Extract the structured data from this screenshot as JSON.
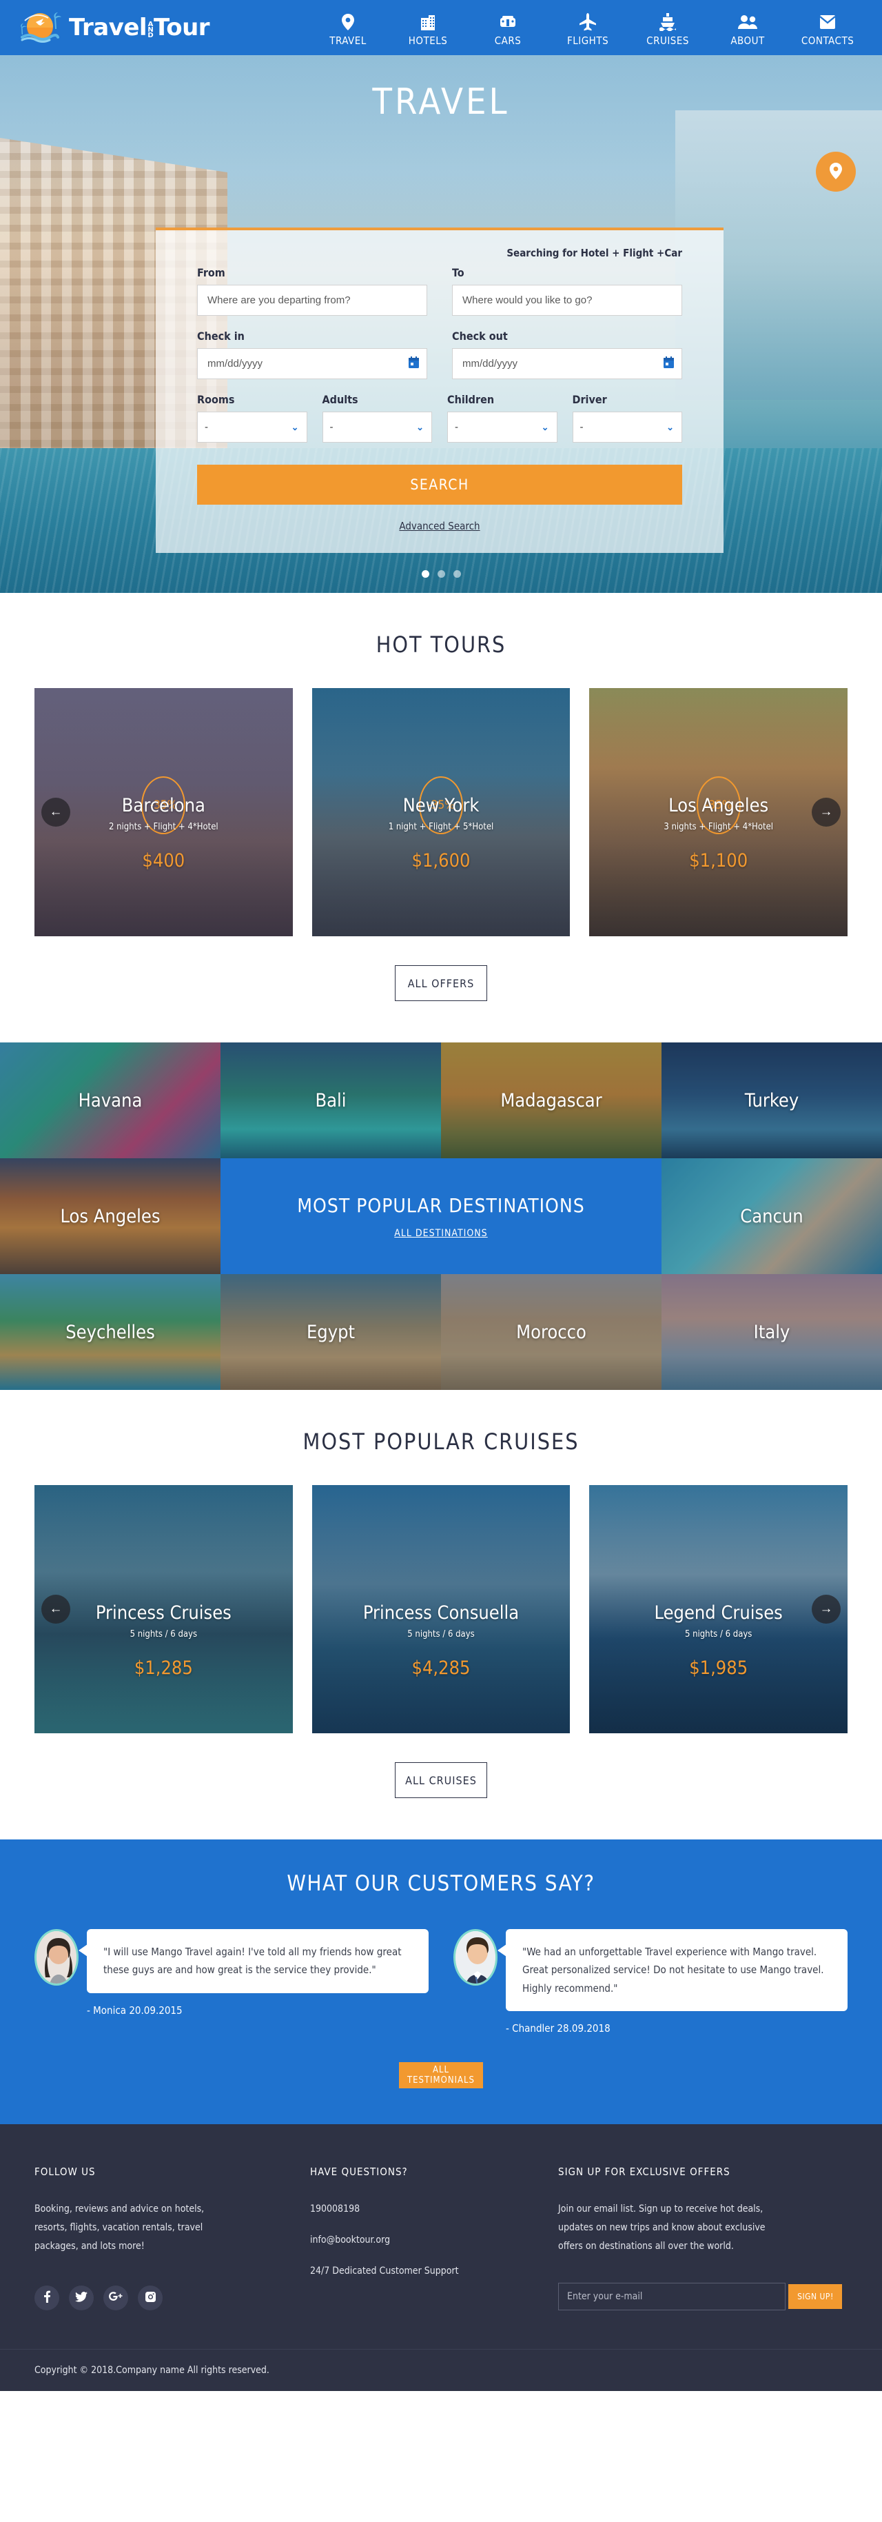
{
  "brand": {
    "name_part1": "Travel",
    "name_and": "AND",
    "name_part2": "Tour",
    "primary_color": "#1f72ce",
    "accent_color": "#f2992f"
  },
  "nav": {
    "items": [
      {
        "label": "TRAVEL",
        "icon": "location-pin-icon"
      },
      {
        "label": "HOTELS",
        "icon": "building-icon"
      },
      {
        "label": "CARS",
        "icon": "car-icon"
      },
      {
        "label": "FLIGHTS",
        "icon": "airplane-icon"
      },
      {
        "label": "CRUISES",
        "icon": "ship-icon"
      },
      {
        "label": "ABOUT",
        "icon": "people-icon"
      },
      {
        "label": "CONTACTS",
        "icon": "envelope-icon"
      }
    ]
  },
  "hero": {
    "title": "TRAVEL",
    "geo_button_icon": "location-pin-icon",
    "carousel_dots": 3,
    "active_dot": 0
  },
  "search_form": {
    "searching_for": "Searching for Hotel + Flight +Car",
    "from_label": "From",
    "from_placeholder": "Where are you departing from?",
    "from_value": "",
    "to_label": "To",
    "to_placeholder": "Where would you like to go?",
    "to_value": "",
    "checkin_label": "Check in",
    "checkin_placeholder": "mm/dd/yyyy",
    "checkin_value": "",
    "checkout_label": "Check out",
    "checkout_placeholder": "mm/dd/yyyy",
    "checkout_value": "",
    "rooms_label": "Rooms",
    "rooms_value": "-",
    "adults_label": "Adults",
    "adults_value": "-",
    "children_label": "Children",
    "children_value": "-",
    "driver_label": "Driver",
    "driver_value": "-",
    "search_button": "SEARCH",
    "advanced_search": "Advanced Search"
  },
  "hot_tours": {
    "title": "HOT TOURS",
    "all_button": "ALL OFFERS",
    "prev_icon": "arrow-left-icon",
    "next_icon": "arrow-right-icon",
    "cards": [
      {
        "name": "Barcelona",
        "sub": "2 nights + Flight + 4*Hotel",
        "price": "$400",
        "discount": "-35%"
      },
      {
        "name": "New York",
        "sub": "1 night + Flight + 5*Hotel",
        "price": "$1,600",
        "discount": "-35%"
      },
      {
        "name": "Los Angeles",
        "sub": "3 nights + Flight + 4*Hotel",
        "price": "$1,100",
        "discount": "-35%"
      }
    ]
  },
  "destinations": {
    "title": "MOST POPULAR DESTINATIONS",
    "all_link": "ALL DESTINATIONS",
    "cells": [
      {
        "name": "Havana"
      },
      {
        "name": "Bali"
      },
      {
        "name": "Madagascar"
      },
      {
        "name": "Turkey"
      },
      {
        "name": "Los Angeles"
      },
      {
        "name": "Cancun"
      },
      {
        "name": "Seychelles"
      },
      {
        "name": "Egypt"
      },
      {
        "name": "Morocco"
      },
      {
        "name": "Italy"
      }
    ]
  },
  "cruises": {
    "title": "MOST POPULAR CRUISES",
    "all_button": "ALL CRUISES",
    "prev_icon": "arrow-left-icon",
    "next_icon": "arrow-right-icon",
    "cards": [
      {
        "name": "Princess Cruises",
        "sub": "5 nights / 6 days",
        "price": "$1,285"
      },
      {
        "name": "Princess Consuella",
        "sub": "5 nights / 6 days",
        "price": "$4,285"
      },
      {
        "name": "Legend Cruises",
        "sub": "5 nights / 6 days",
        "price": "$1,985"
      }
    ]
  },
  "testimonials": {
    "title": "WHAT OUR CUSTOMERS SAY?",
    "all_button": "ALL TESTIMONIALS",
    "items": [
      {
        "quote": "\"I will use Mango Travel again! I've told all my friends how great these guys are and how great is the service they provide.\"",
        "author": "- Monica  20.09.2015"
      },
      {
        "quote": "\"We had an unforgettable Travel experience with Mango travel. Great personalized service! Do not hesitate to use Mango travel. Highly recommend.\"",
        "author": "- Chandler  28.09.2018"
      }
    ]
  },
  "footer": {
    "follow": {
      "heading": "FOLLOW US",
      "text": "Booking, reviews and advice on hotels, resorts, flights, vacation rentals, travel packages, and lots more!",
      "socials": [
        {
          "name": "facebook-icon"
        },
        {
          "name": "twitter-icon"
        },
        {
          "name": "google-plus-icon"
        },
        {
          "name": "instagram-icon"
        }
      ]
    },
    "questions": {
      "heading": "HAVE QUESTIONS?",
      "phone": "190008198",
      "email": "info@booktour.org",
      "support": "24/7 Dedicated Customer Support"
    },
    "signup": {
      "heading": "SIGN UP FOR EXCLUSIVE OFFERS",
      "text": "Join our email list. Sign up to receive hot deals, updates on new trips and know about exclusive offers on destinations all over the world.",
      "email_placeholder": "Enter your e-mail",
      "email_value": "",
      "button": "SIGN UP!"
    },
    "copyright": "Copyright © 2018.Company name All rights reserved."
  }
}
